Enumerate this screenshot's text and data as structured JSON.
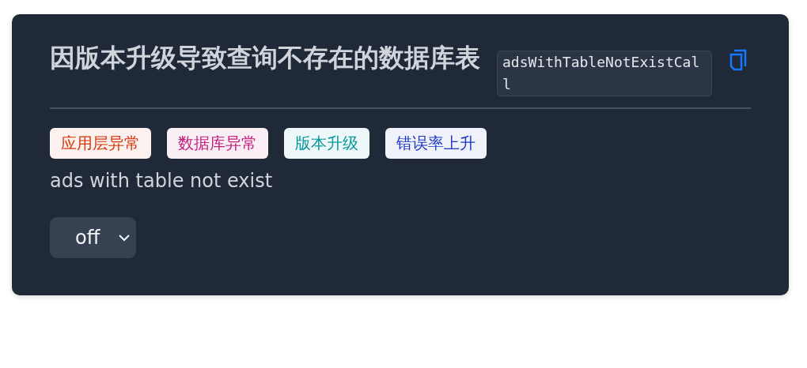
{
  "card": {
    "title": "因版本升级导致查询不存在的数据库表",
    "code": "adsWithTableNotExistCall",
    "tags": [
      {
        "label": "应用层异常",
        "color": "#d4380d"
      },
      {
        "label": "数据库异常",
        "color": "#c41d7f"
      },
      {
        "label": "版本升级",
        "color": "#08979c"
      },
      {
        "label": "错误率上升",
        "color": "#1d39c4"
      }
    ],
    "description": "ads with table not exist",
    "select": {
      "value": "off"
    }
  }
}
